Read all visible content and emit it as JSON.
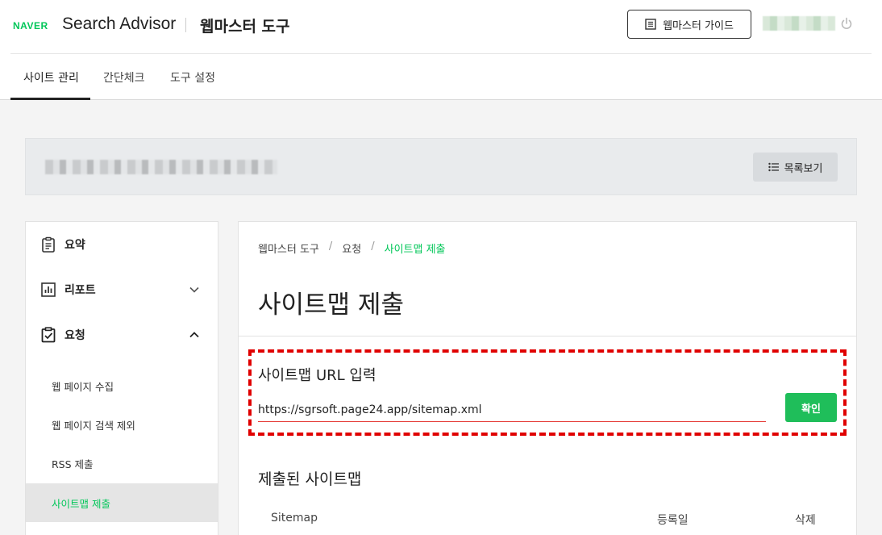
{
  "header": {
    "logo": "NAVER",
    "brand": "Search Advisor",
    "tool_title": "웹마스터 도구",
    "guide_button": "웹마스터 가이드"
  },
  "tabs": [
    {
      "label": "사이트 관리",
      "active": true
    },
    {
      "label": "간단체크",
      "active": false
    },
    {
      "label": "도구 설정",
      "active": false
    }
  ],
  "sitebar": {
    "list_button": "목록보기"
  },
  "sidebar": {
    "items": [
      {
        "label": "요약",
        "icon": "clipboard-icon"
      },
      {
        "label": "리포트",
        "icon": "chart-icon",
        "expanded": false
      },
      {
        "label": "요청",
        "icon": "check-clipboard-icon",
        "expanded": true
      }
    ],
    "sub_items": [
      {
        "label": "웹 페이지 수집",
        "active": false
      },
      {
        "label": "웹 페이지 검색 제외",
        "active": false
      },
      {
        "label": "RSS 제출",
        "active": false
      },
      {
        "label": "사이트맵 제출",
        "active": true
      }
    ]
  },
  "main": {
    "breadcrumb": [
      "웹마스터 도구",
      "요청",
      "사이트맵 제출"
    ],
    "page_title": "사이트맵 제출",
    "url_field_label": "사이트맵 URL 입력",
    "url_value": "https://sgrsoft.page24.app/sitemap.xml",
    "confirm_button": "확인",
    "submitted_title": "제출된 사이트맵",
    "table_headers": [
      "Sitemap",
      "등록일",
      "삭제"
    ]
  },
  "colors": {
    "accent": "#03c75a",
    "button_green": "#1fbe5a",
    "highlight": "#e00000"
  }
}
